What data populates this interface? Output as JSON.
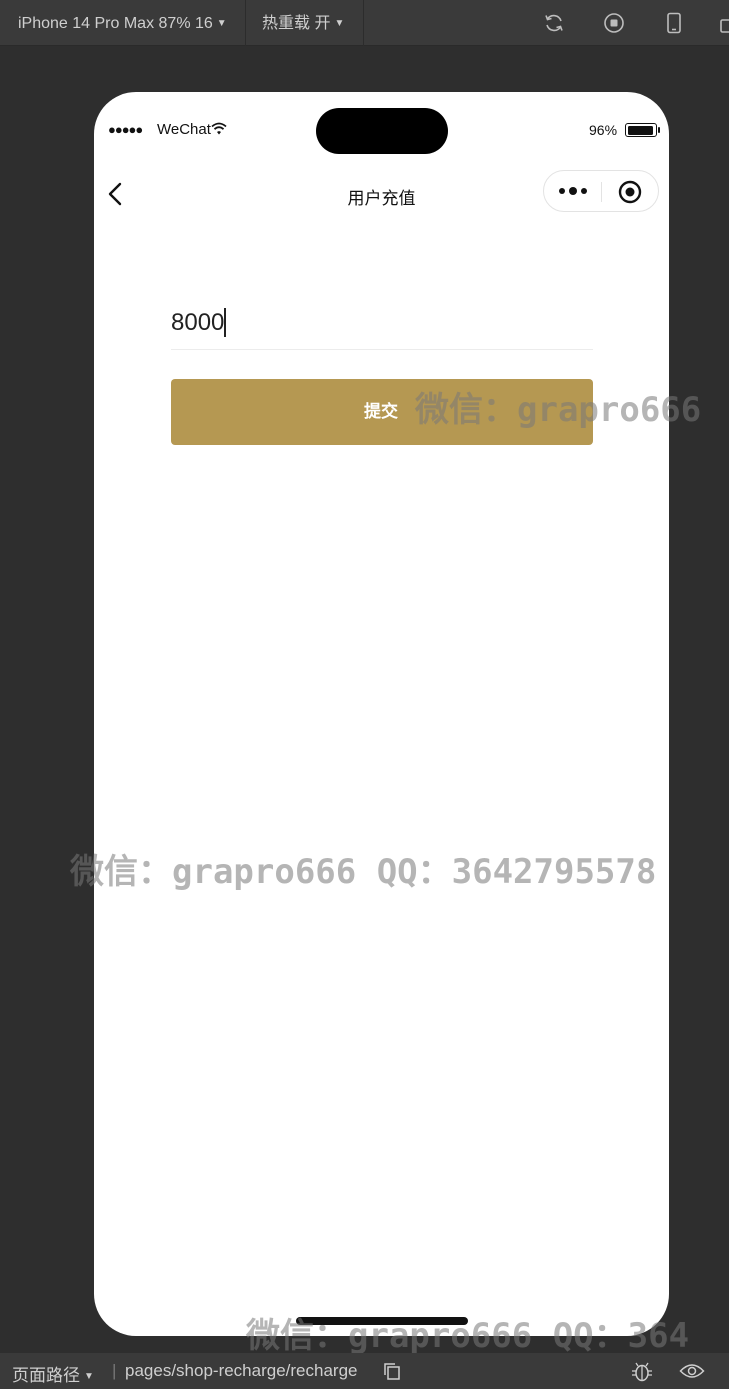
{
  "toolbar": {
    "device_label": "iPhone 14 Pro Max 87% 16",
    "hot_reload_label": "热重载 开"
  },
  "status_bar": {
    "signal": "●●●●●",
    "carrier": "WeChat",
    "battery_percent": "96%",
    "battery_level": 0.96
  },
  "navbar": {
    "title": "用户充值"
  },
  "form": {
    "amount_value": "8000",
    "submit_label": "提交"
  },
  "watermarks": {
    "top": "微信：grapro666",
    "middle": "微信：grapro666 QQ：3642795578",
    "bottom": "微信：grapro666 QQ：364"
  },
  "bottom_bar": {
    "path_label": "页面路径",
    "separator": "|",
    "path": "pages/shop-recharge/recharge"
  },
  "colors": {
    "accent": "#b59852",
    "ide_background": "#2e2e2e",
    "toolbar_background": "#3a3a3a"
  }
}
